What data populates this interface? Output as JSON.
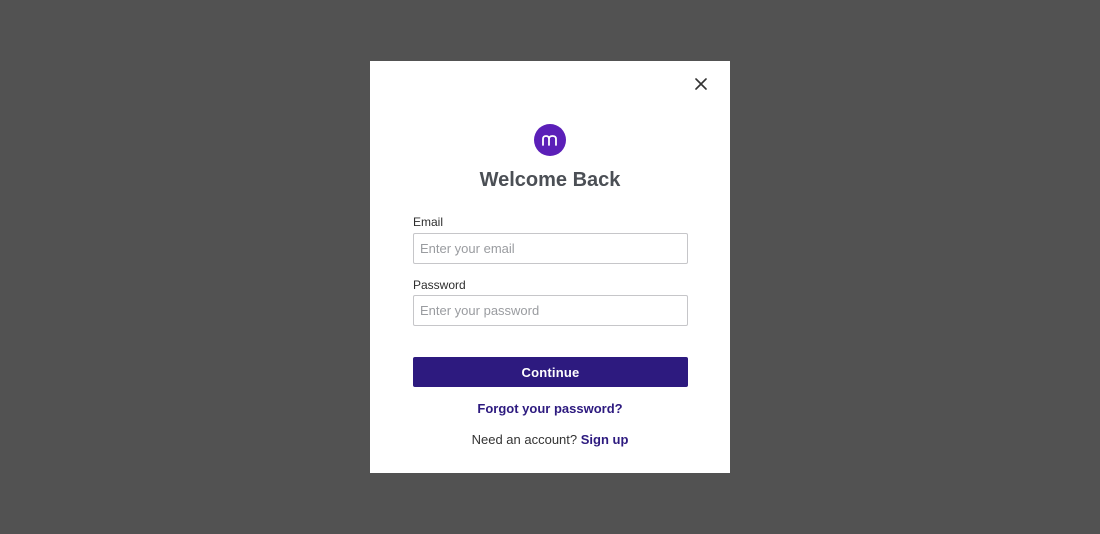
{
  "colors": {
    "backdrop": "#525252",
    "accent": "#2d1a7f",
    "logo": "#5b1fb8"
  },
  "modal": {
    "close_icon": "close-icon",
    "logo_icon": "brand-m-logo",
    "logo_letter": "m",
    "title": "Welcome Back",
    "email": {
      "label": "Email",
      "placeholder": "Enter your email",
      "value": ""
    },
    "password": {
      "label": "Password",
      "placeholder": "Enter your password",
      "value": ""
    },
    "continue_label": "Continue",
    "forgot_label": "Forgot your password?",
    "signup_prompt": "Need an account?",
    "signup_label": "Sign up"
  }
}
